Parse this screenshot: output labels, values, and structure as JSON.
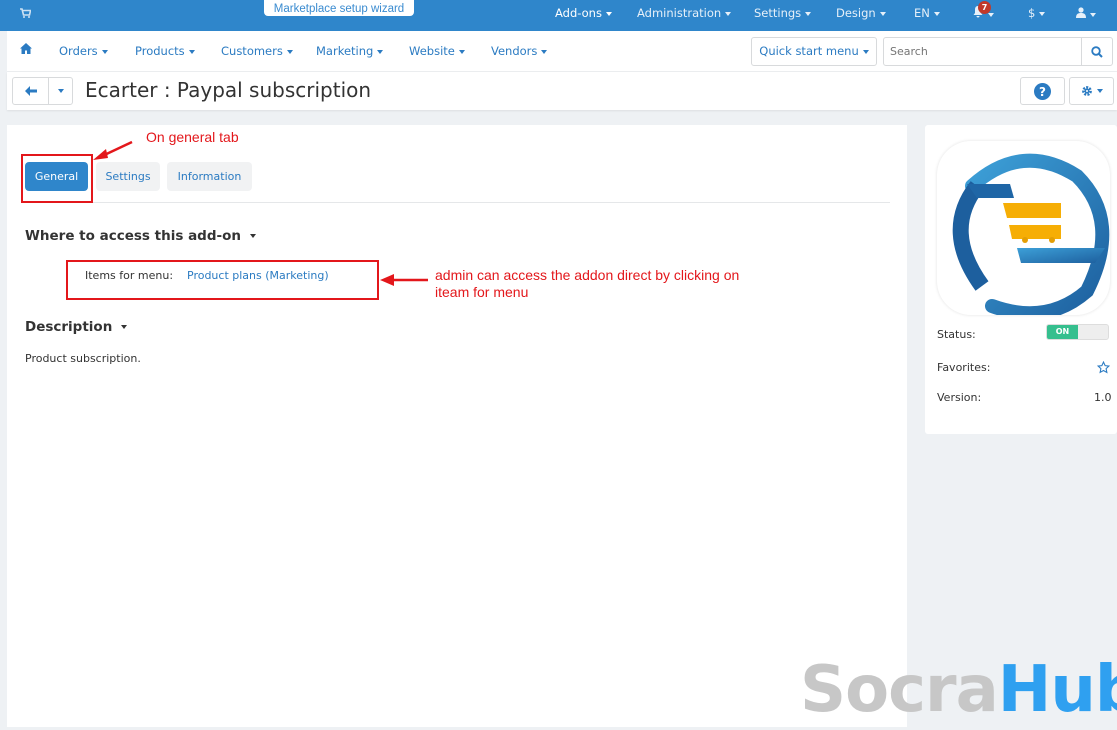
{
  "topbar": {
    "wizard_label": "Marketplace setup wizard",
    "items": [
      "Add-ons",
      "Administration",
      "Settings",
      "Design",
      "EN"
    ],
    "notification_count": "7",
    "currency": "$"
  },
  "navbar": {
    "items": [
      "Orders",
      "Products",
      "Customers",
      "Marketing",
      "Website",
      "Vendors"
    ],
    "quick_start": "Quick start menu",
    "search_placeholder": "Search"
  },
  "page": {
    "title": "Ecarter : Paypal subscription"
  },
  "tabs": [
    {
      "label": "General",
      "active": true
    },
    {
      "label": "Settings"
    },
    {
      "label": "Information"
    }
  ],
  "sections": {
    "access": {
      "heading": "Where to access this add-on",
      "label": "Items for menu:",
      "link": "Product plans (Marketing)"
    },
    "description": {
      "heading": "Description",
      "text": "Product subscription."
    }
  },
  "sidebar": {
    "status_label": "Status:",
    "status_value": "ON",
    "favorites_label": "Favorites:",
    "version_label": "Version:",
    "version_value": "1.0"
  },
  "annotations": {
    "tab_note": "On general tab",
    "menu_note_line1": "admin can access the addon direct by clicking on",
    "menu_note_line2": "iteam for menu"
  },
  "watermark": {
    "part1": "Socra",
    "part2": "Hub"
  },
  "colors": {
    "primary": "#2f86cb",
    "annotation": "#e3171b",
    "on": "#35bf8e"
  }
}
